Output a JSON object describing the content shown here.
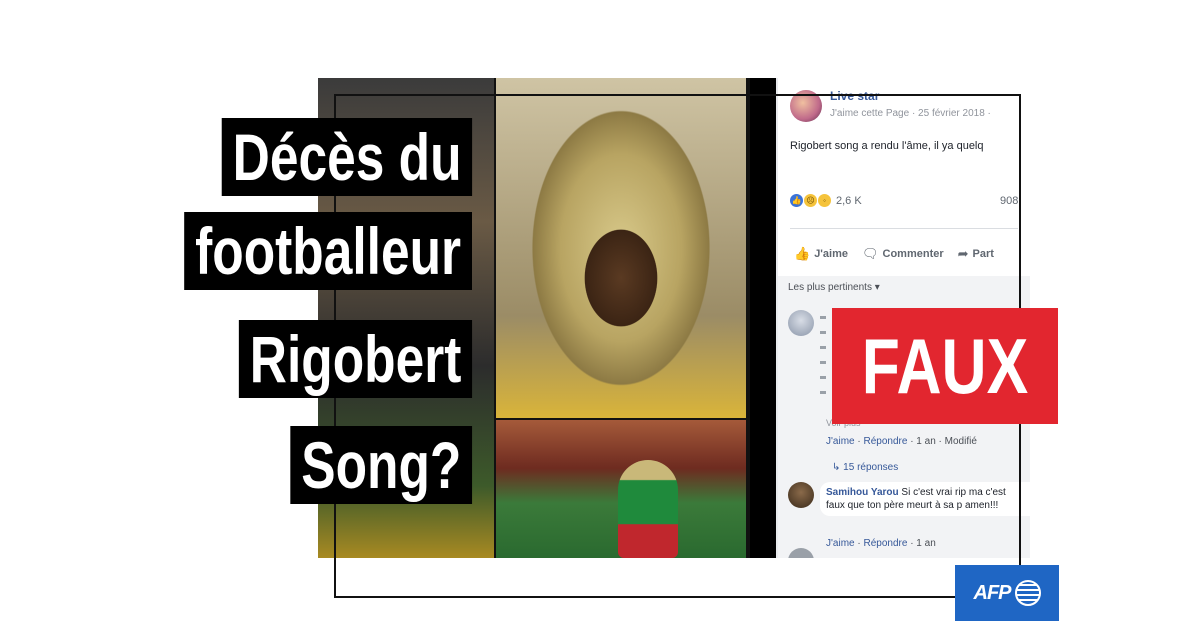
{
  "headline": {
    "line1": "Décès du",
    "line2": "footballeur",
    "line3": "Rigobert",
    "line4": "Song?"
  },
  "verdict": "FAUX",
  "logo": "AFP",
  "post": {
    "author": "Live star",
    "meta": "J'aime cette Page · 25 février 2018 · ",
    "text": "Rigobert song a rendu l'âme, il ya quelq",
    "reaction_count": "2,6 K",
    "comment_count": "908",
    "actions": {
      "like": "J'aime",
      "comment": "Commenter",
      "share": "Part"
    },
    "sort_label": "Les plus pertinents ▾"
  },
  "comments": [
    {
      "more": "Voir plus",
      "footer_like": "J'aime",
      "footer_reply": "Répondre",
      "footer_meta": "· 1 an · Modifié",
      "replies": "15 réponses"
    },
    {
      "author": "Samihou Yarou",
      "text": "Si c'est vrai rip ma c'est faux que ton père meurt à sa p amen!!!",
      "footer_like": "J'aime",
      "footer_reply": "Répondre",
      "footer_meta": "· 1 an"
    }
  ],
  "colors": {
    "verdict_bg": "#e2262f",
    "afp_blue": "#1f66c4",
    "fb_link": "#365899"
  }
}
